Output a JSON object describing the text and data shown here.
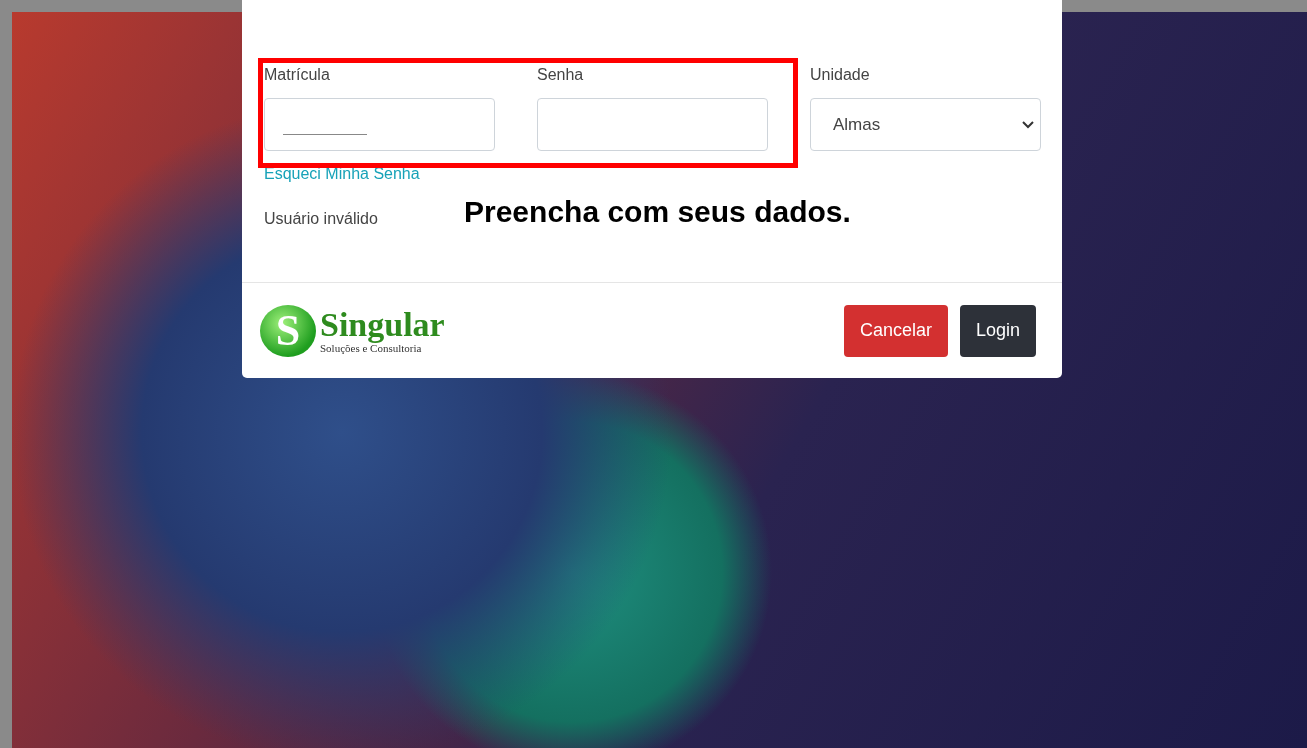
{
  "login_dialog": {
    "fields": [
      {
        "label": "Matrícula",
        "redacted": true
      },
      {
        "label": "Senha",
        "redacted": false
      }
    ],
    "unit": {
      "label": "Unidade",
      "value": "Almas"
    },
    "forgot_link": "Esqueci Minha Senha",
    "error_message": "Usuário inválido",
    "annotation": "Preencha com seus dados.",
    "logo": {
      "mark": "S",
      "name": "Singular",
      "tagline": "Soluções e Consultoria"
    },
    "buttons": [
      {
        "label": "Cancelar",
        "kind": "danger"
      },
      {
        "label": "Login",
        "kind": "dark"
      }
    ]
  }
}
